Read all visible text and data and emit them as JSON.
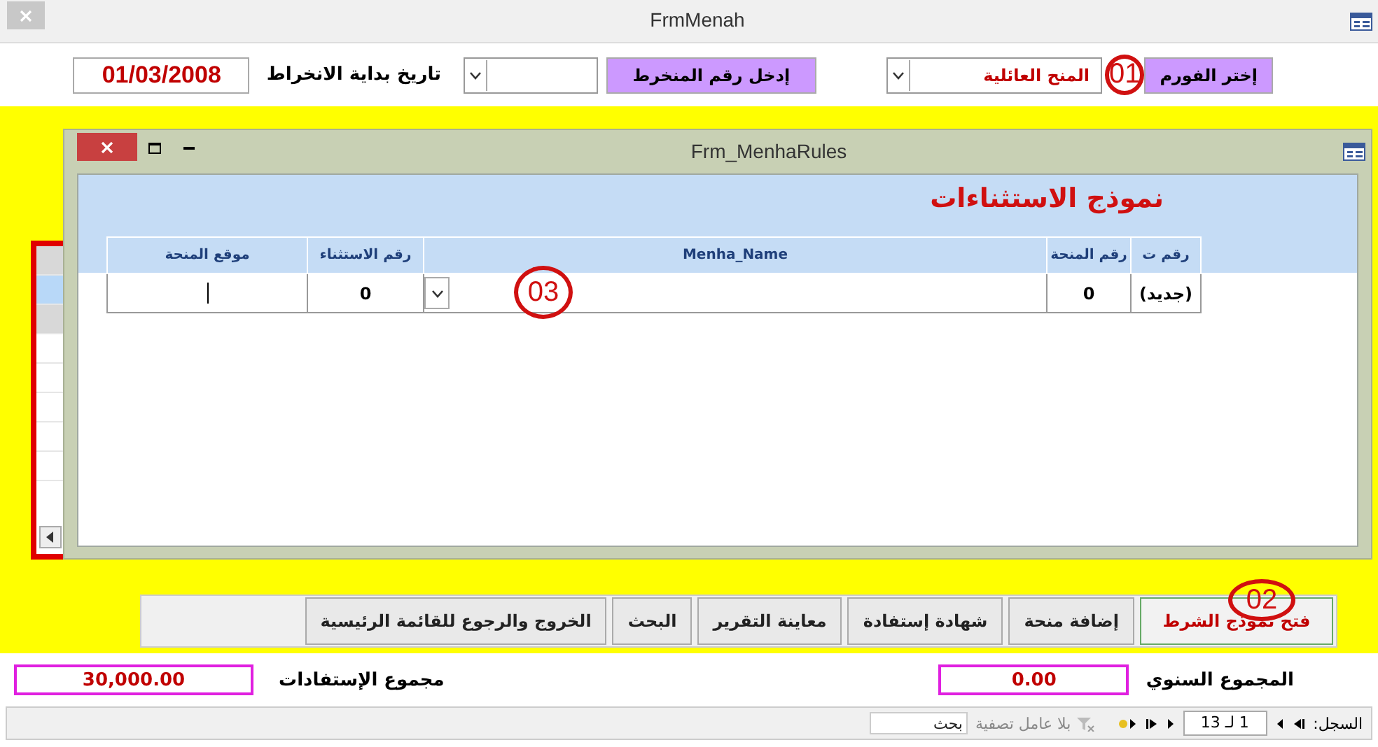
{
  "window": {
    "title": "FrmMenah"
  },
  "header": {
    "form_button": "إختر الفورم",
    "annotation": "01",
    "form_combo": {
      "value": "المنح العائلية"
    },
    "member_button": "إدخل رقم المنخرط",
    "start_date_label": "تاريخ بداية الانخراط",
    "start_date": "01/03/2008"
  },
  "subwindow": {
    "title": "Frm_MenhaRules",
    "heading": "نموذج الاستثناءات",
    "columns": [
      "رقم ت",
      "رقم المنحة",
      "Menha_Name",
      "رقم الاستثناء",
      "موقع المنحة"
    ],
    "rows": [
      {
        "record": "(جديد)",
        "menha_no": "0",
        "exception_no": "0"
      }
    ],
    "annotation": "03"
  },
  "buttons": [
    {
      "label": "فتح نموذج الشرط",
      "kind": "primary",
      "annotation": "02"
    },
    {
      "label": "إضافة منحة",
      "kind": "normal"
    },
    {
      "label": "شهادة إستفادة",
      "kind": "normal"
    },
    {
      "label": "معاينة التقرير",
      "kind": "normal"
    },
    {
      "label": "البحث",
      "kind": "normal"
    },
    {
      "label": "الخروج والرجوع للقائمة الرئيسية",
      "kind": "normal"
    }
  ],
  "totals": [
    {
      "label": "المجموع السنوي",
      "value": "0.00"
    },
    {
      "label": "مجموع الإستفادات",
      "value": "30,000.00"
    }
  ],
  "status_bar": {
    "record_label": "السجل:",
    "record_position": "1 لـ 13",
    "filter": "بلا عامل تصفية",
    "search_placeholder": "بحث"
  }
}
